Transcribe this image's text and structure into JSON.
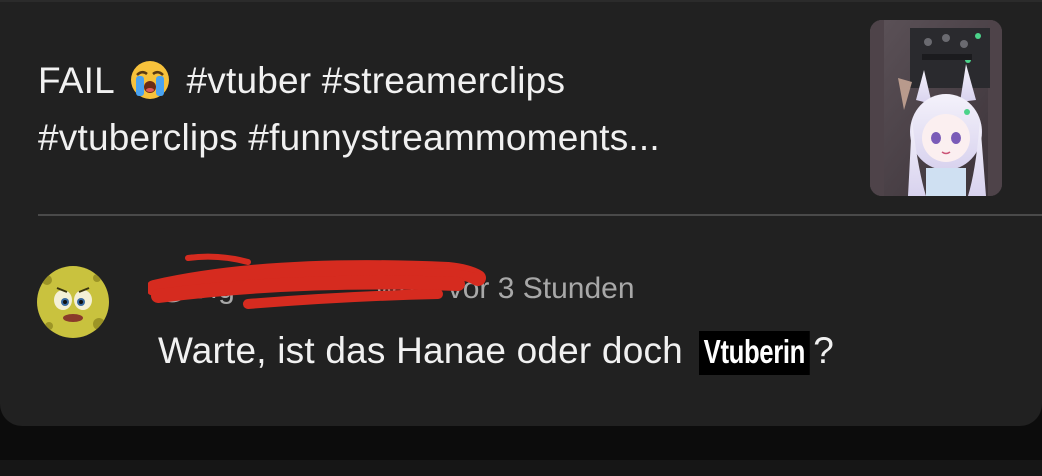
{
  "video": {
    "title_line1_prefix": "FAIL",
    "title_emoji": "loudly-crying-face-emoji",
    "title_line1_suffix": "#vtuber #streamerclips",
    "title_line2": "#vtuberclips #funnystreammoments..."
  },
  "comment": {
    "author_handle": "@Sig               wr0",
    "separator": "•",
    "timestamp": "vor 3 Stunden",
    "text_before": "Warte, ist das Hanae oder doch",
    "censored_word": "Vtuberin",
    "text_after": "?"
  },
  "colors": {
    "card_bg": "#212121",
    "page_bg": "#0c0c0c",
    "text_primary": "#f1f1f1",
    "text_secondary": "#a8a8a8",
    "redaction": "#d62b1f"
  }
}
